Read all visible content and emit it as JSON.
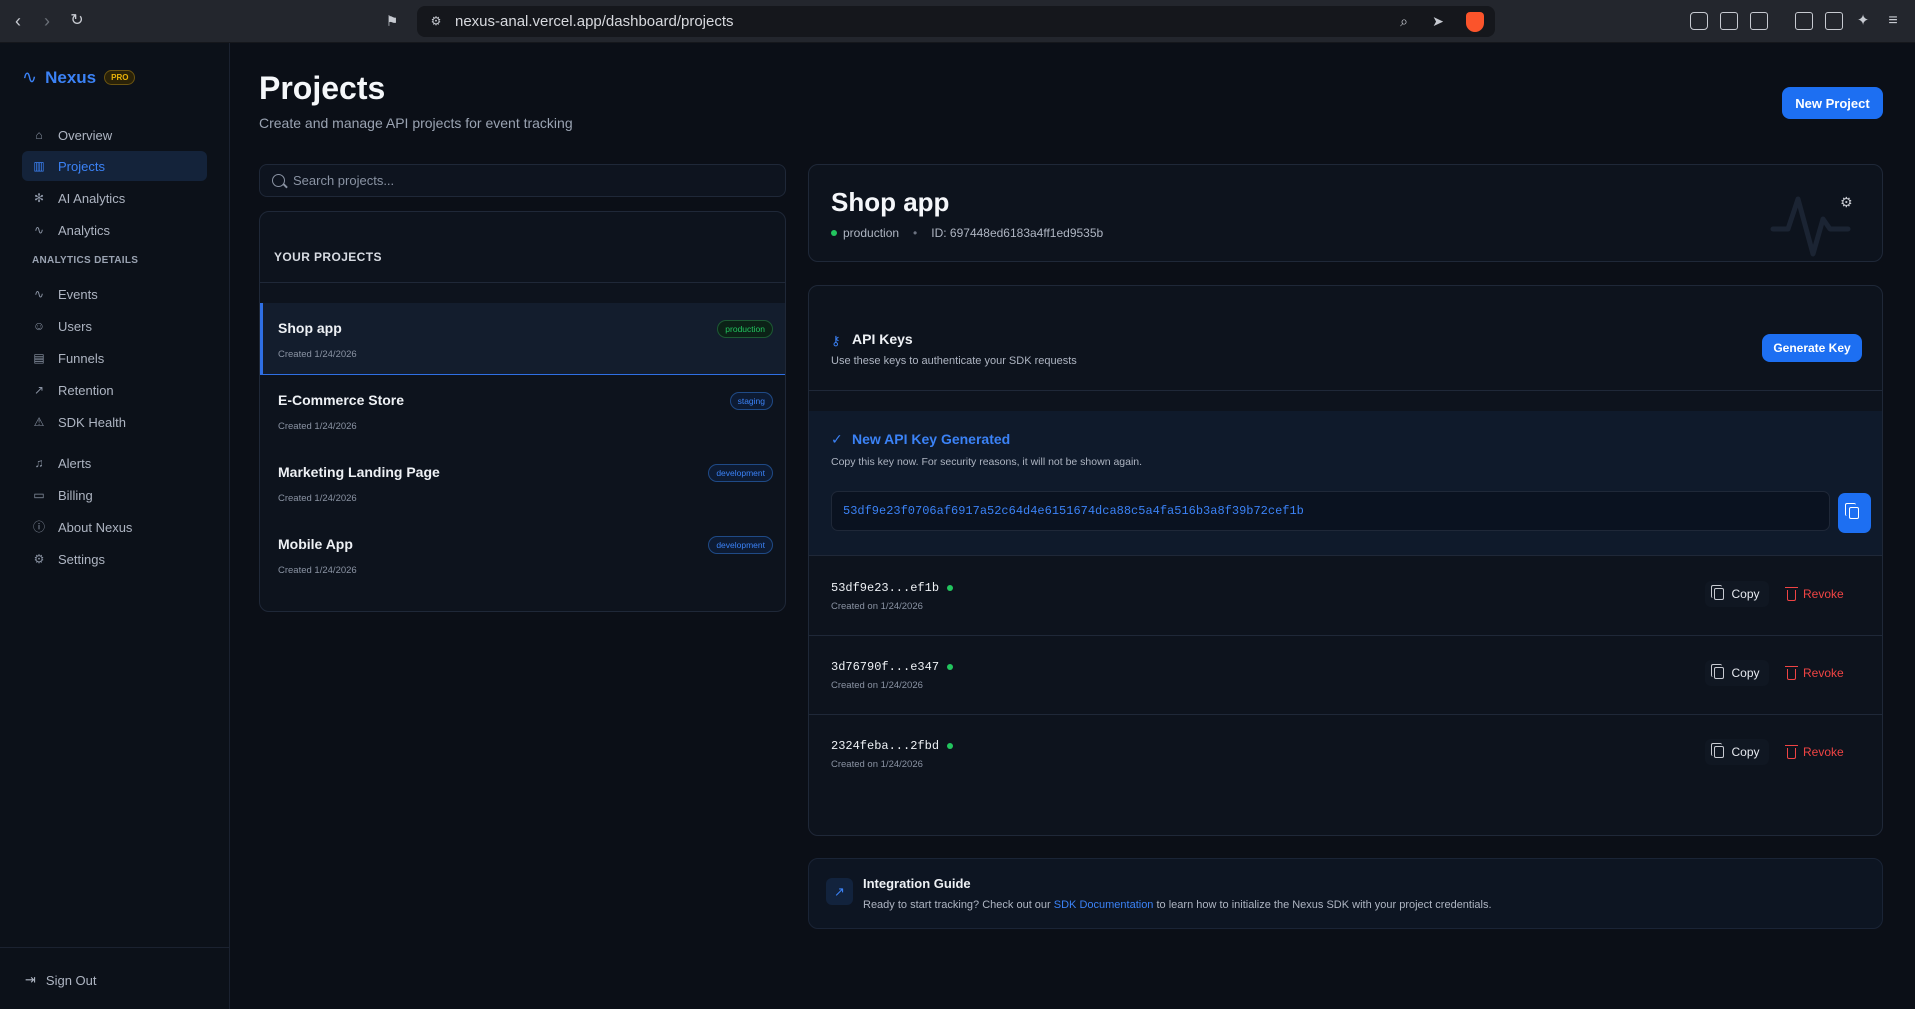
{
  "browser": {
    "url": "nexus-anal.vercel.app/dashboard/projects"
  },
  "sidebar": {
    "logo": "Nexus",
    "badge": "PRO",
    "items": [
      {
        "label": "Overview",
        "icon": "home-icon"
      },
      {
        "label": "Projects",
        "icon": "chart-icon",
        "active": true
      },
      {
        "label": "AI Analytics",
        "icon": "sparkle-icon"
      },
      {
        "label": "Analytics",
        "icon": "pulse-icon"
      }
    ],
    "section_label": "ANALYTICS DETAILS",
    "detail_items": [
      {
        "label": "Events",
        "icon": "pulse-icon"
      },
      {
        "label": "Users",
        "icon": "users-icon"
      },
      {
        "label": "Funnels",
        "icon": "funnel-icon"
      },
      {
        "label": "Retention",
        "icon": "trend-icon"
      },
      {
        "label": "SDK Health",
        "icon": "warning-icon"
      }
    ],
    "bottom_items": [
      {
        "label": "Alerts",
        "icon": "bell-icon"
      },
      {
        "label": "Billing",
        "icon": "card-icon"
      },
      {
        "label": "About Nexus",
        "icon": "info-icon"
      },
      {
        "label": "Settings",
        "icon": "gear-icon"
      }
    ],
    "signout": "Sign Out"
  },
  "header": {
    "title": "Projects",
    "subtitle": "Create and manage API projects for event tracking",
    "new_project": "New Project"
  },
  "search": {
    "placeholder": "Search projects..."
  },
  "projects": {
    "heading": "YOUR PROJECTS",
    "items": [
      {
        "name": "Shop app",
        "created": "Created 1/24/2026",
        "env": "production"
      },
      {
        "name": "E-Commerce Store",
        "created": "Created 1/24/2026",
        "env": "staging"
      },
      {
        "name": "Marketing Landing Page",
        "created": "Created 1/24/2026",
        "env": "development"
      },
      {
        "name": "Mobile App",
        "created": "Created 1/24/2026",
        "env": "development"
      }
    ]
  },
  "detail": {
    "name": "Shop app",
    "env": "production",
    "id": "ID: 697448ed6183a4ff1ed9535b"
  },
  "api_keys": {
    "title": "API Keys",
    "subtitle": "Use these keys to authenticate your SDK requests",
    "generate": "Generate Key",
    "new_key": {
      "title": "New API Key Generated",
      "note": "Copy this key now. For security reasons, it will not be shown again.",
      "value": "53df9e23f0706af6917a52c64d4e6151674dca88c5a4fa516b3a8f39b72cef1b"
    },
    "keys": [
      {
        "masked": "53df9e23...ef1b",
        "created": "Created on 1/24/2026"
      },
      {
        "masked": "3d76790f...e347",
        "created": "Created on 1/24/2026"
      },
      {
        "masked": "2324feba...2fbd",
        "created": "Created on 1/24/2026"
      }
    ],
    "copy_label": "Copy",
    "revoke_label": "Revoke"
  },
  "guide": {
    "title": "Integration Guide",
    "text_before": "Ready to start tracking? Check out our ",
    "link": "SDK Documentation",
    "text_after": " to learn how to initialize the Nexus SDK with your project credentials."
  },
  "colors": {
    "accent": "#1d6ff2",
    "success": "#22c55e",
    "danger": "#ef4444",
    "background": "#0b0f17"
  }
}
